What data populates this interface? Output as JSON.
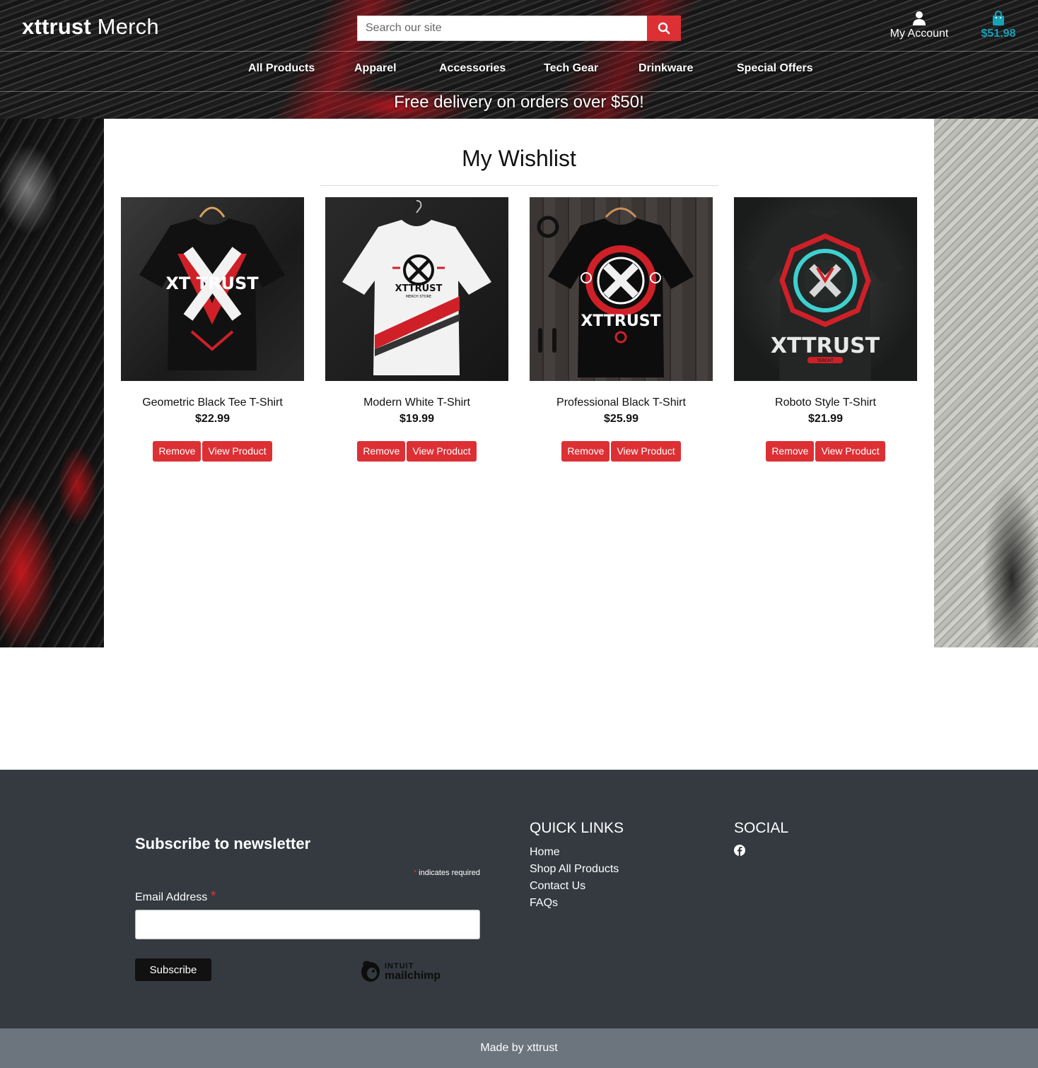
{
  "header": {
    "logo_bold": "xttrust",
    "logo_rest": " Merch",
    "search_placeholder": "Search our site",
    "account_label": "My Account",
    "cart_total": "$51.98",
    "promo": "Free delivery on orders over $50!"
  },
  "nav": [
    "All Products",
    "Apparel",
    "Accessories",
    "Tech Gear",
    "Drinkware",
    "Special Offers"
  ],
  "main": {
    "title": "My Wishlist",
    "remove_label": "Remove",
    "view_label": "View Product"
  },
  "products": [
    {
      "name": "Geometric Black Tee T-Shirt",
      "price": "$22.99",
      "image_text": "XT TRUST",
      "shirt_color": "#111111",
      "print_color": "#ffffff"
    },
    {
      "name": "Modern White T-Shirt",
      "price": "$19.99",
      "image_text": "XTTRUST",
      "image_subtext": "MERCH STORE",
      "shirt_color": "#f2f2f2",
      "print_color": "#111111"
    },
    {
      "name": "Professional Black T-Shirt",
      "price": "$25.99",
      "image_text": "XTTRUST",
      "shirt_color": "#111111",
      "print_color": "#ffffff"
    },
    {
      "name": "Roboto Style T-Shirt",
      "price": "$21.99",
      "image_text": "XTTRUST",
      "image_subtext": "TERCHT",
      "shirt_color": "#1c1f1e",
      "print_color": "#e8e8e8"
    }
  ],
  "footer": {
    "newsletter_title": "Subscribe to newsletter",
    "required_ast": "*",
    "required_note": " indicates required",
    "email_label": "Email Address ",
    "email_ast": "*",
    "subscribe_label": "Subscribe",
    "mc_small": "INTUIT",
    "mc_big": "mailchimp",
    "quick_links_title": "QUICK LINKS",
    "quick_links": [
      "Home",
      "Shop All Products",
      "Contact Us",
      "FAQs"
    ],
    "social_title": "SOCIAL",
    "made_by": "Made by xttrust"
  },
  "colors": {
    "accent_red": "#dc3035",
    "cart_teal": "#17a2b8",
    "footer_dark": "#343a40",
    "footer_bar": "#6c757d"
  },
  "icons": {
    "search": "search-icon",
    "account": "user-icon",
    "cart": "shopping-bag-icon",
    "social": "facebook-icon"
  }
}
